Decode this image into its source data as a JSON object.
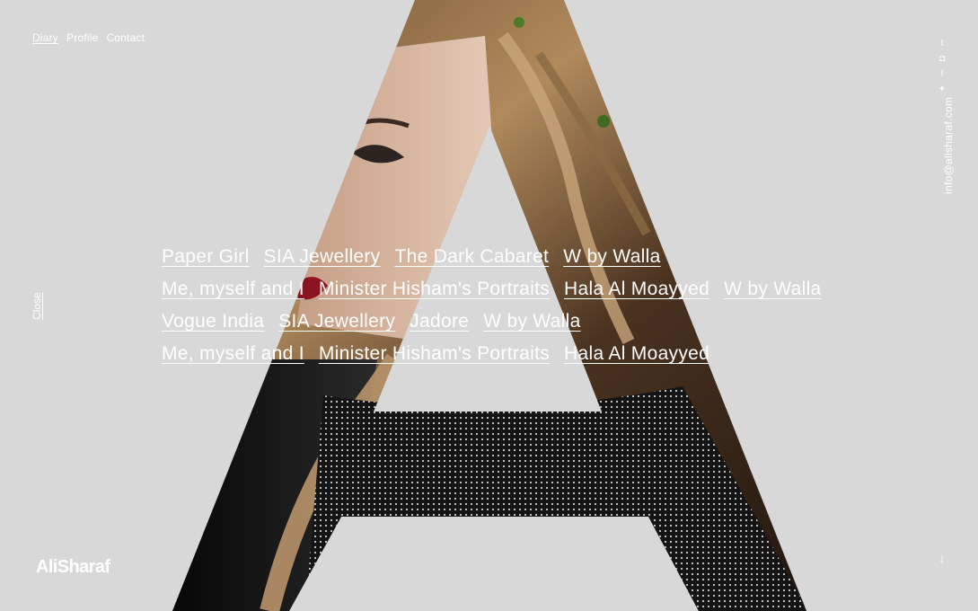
{
  "nav": {
    "items": [
      {
        "label": "Diary",
        "active": true
      },
      {
        "label": "Profile",
        "active": false
      },
      {
        "label": "Contact",
        "active": false
      }
    ]
  },
  "social": {
    "icons": [
      "tumblr-icon",
      "instagram-icon",
      "facebook-icon",
      "twitter-icon"
    ],
    "glyphs": [
      "t",
      "◘",
      "f",
      "✦"
    ]
  },
  "email": "info@alisharaf.com",
  "close_label": "Close",
  "projects": {
    "rows": [
      [
        "Paper Girl",
        "SIA Jewellery",
        "The Dark Cabaret",
        "W by Walla"
      ],
      [
        "Me, myself and I",
        "Minister Hisham's Portraits",
        "Hala Al Moayyed",
        "W by Walla"
      ],
      [
        "Vogue India",
        "SIA Jewellery",
        "Jadore",
        "W by Walla"
      ],
      [
        "Me, myself and I",
        "Minister Hisham's Portraits",
        "Hala Al Moayyed"
      ]
    ]
  },
  "logo": "AliSharaf",
  "scroll_arrow": "↓",
  "colors": {
    "background": "#d8d8d8",
    "text": "#ffffff",
    "hair_dark": "#3b2a1a",
    "hair_light": "#a88458",
    "garment": "#1a1a1a",
    "lips": "#8c1420",
    "skin": "#d9b9a3"
  }
}
